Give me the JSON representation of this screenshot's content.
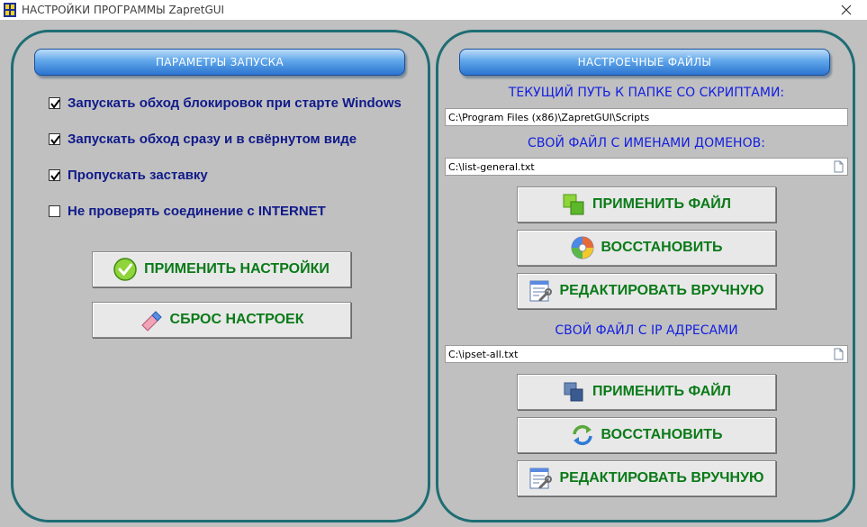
{
  "window": {
    "title": "НАСТРОЙКИ ПРОГРАММЫ ZapretGUI",
    "close_glyph": "✕"
  },
  "left": {
    "header": "ПАРАМЕТРЫ ЗАПУСКА",
    "checkboxes": [
      {
        "label": "Запускать обход блокировок при старте Windows",
        "checked": true
      },
      {
        "label": "Запускать обход сразу и в свёрнутом виде",
        "checked": true
      },
      {
        "label": "Пропускать заставку",
        "checked": true
      },
      {
        "label": "Не проверять соединение с INTERNET",
        "checked": false
      }
    ],
    "apply_button": "ПРИМЕНИТЬ НАСТРОЙКИ",
    "reset_button": "СБРОС НАСТРОЕК"
  },
  "right": {
    "header": "НАСТРОЕЧНЫЕ  ФАЙЛЫ",
    "scripts_path_label": "ТЕКУЩИЙ ПУТЬ К ПАПКЕ СО СКРИПТАМИ:",
    "scripts_path_value": "C:\\Program Files (x86)\\ZapretGUI\\Scripts",
    "domains_label": "СВОЙ ФАЙЛ С ИМЕНАМИ ДОМЕНОВ:",
    "domains_value": "C:\\list-general.txt",
    "domains_buttons": {
      "apply": "ПРИМЕНИТЬ ФАЙЛ",
      "restore": "ВОССТАНОВИТЬ",
      "edit": "РЕДАКТИРОВАТЬ ВРУЧНУЮ"
    },
    "ip_label": "СВОЙ ФАЙЛ С IP АДРЕСАМИ",
    "ip_value": "C:\\ipset-all.txt",
    "ip_buttons": {
      "apply": "ПРИМЕНИТЬ ФАЙЛ",
      "restore": "ВОССТАНОВИТЬ",
      "edit": "РЕДАКТИРОВАТЬ ВРУЧНУЮ"
    }
  },
  "colors": {
    "background": "#c0c0c0",
    "panel_border": "#1f6d74",
    "checkbox_label": "#101a8a",
    "button_text": "#0a7a18",
    "blue_label": "#1420e0"
  },
  "icons": [
    "app-icon",
    "close-icon",
    "check-circle-icon",
    "eraser-icon",
    "green-squares-icon",
    "disc-icon",
    "wrench-list-icon",
    "blue-squares-icon",
    "refresh-arrows-icon",
    "document-icon"
  ]
}
